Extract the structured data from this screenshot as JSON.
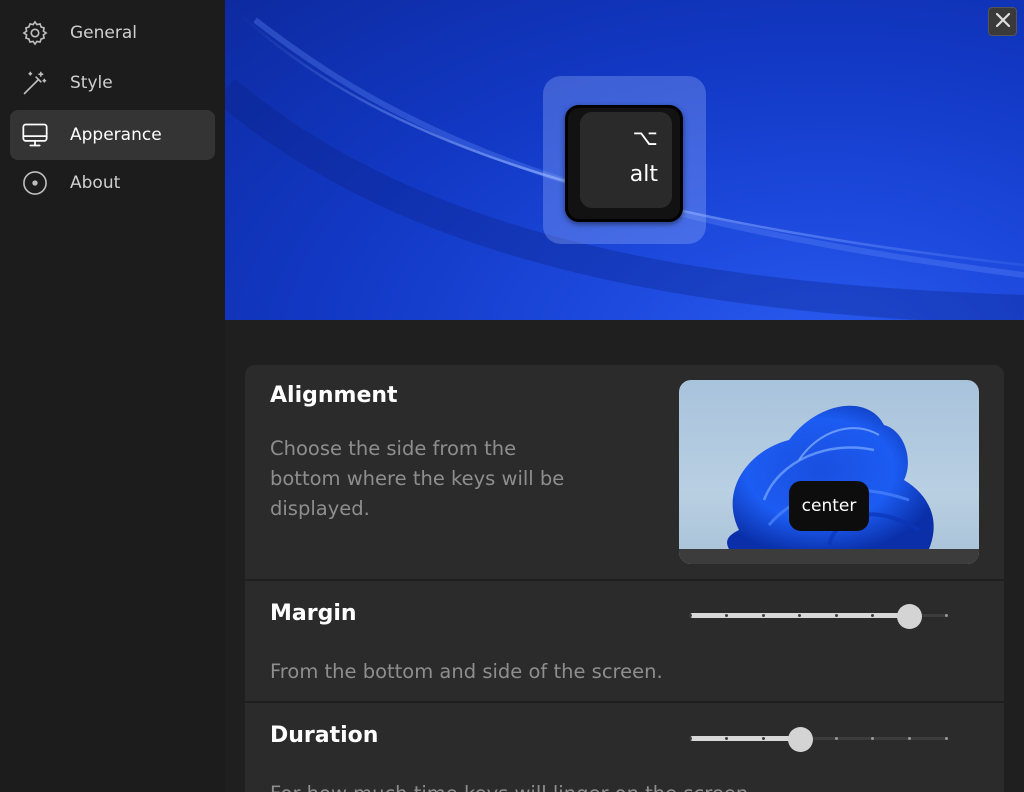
{
  "sidebar": {
    "items": [
      {
        "label": "General",
        "icon": "gear-icon"
      },
      {
        "label": "Style",
        "icon": "magic-wand-icon"
      },
      {
        "label": "Apperance",
        "icon": "monitor-icon",
        "active": true
      },
      {
        "label": "About",
        "icon": "disc-icon"
      }
    ]
  },
  "hero": {
    "key_symbol": "⌥",
    "key_label": "alt",
    "close_icon": "close-icon"
  },
  "settings": {
    "alignment": {
      "title": "Alignment",
      "description": "Choose the side from the bottom where the keys will be displayed.",
      "preview_label": "center"
    },
    "margin": {
      "title": "Margin",
      "description": "From the bottom and side of the screen.",
      "value_fraction": 0.857,
      "steps": 7
    },
    "duration": {
      "title": "Duration",
      "description": "For how much time keys will linger on the screen.",
      "value_fraction": 0.429,
      "steps": 7
    }
  },
  "colors": {
    "accent_blue": "#1c48db",
    "sidebar_bg": "#1c1c1c",
    "card_bg": "#2b2b2b",
    "active_item_bg": "#343434"
  }
}
